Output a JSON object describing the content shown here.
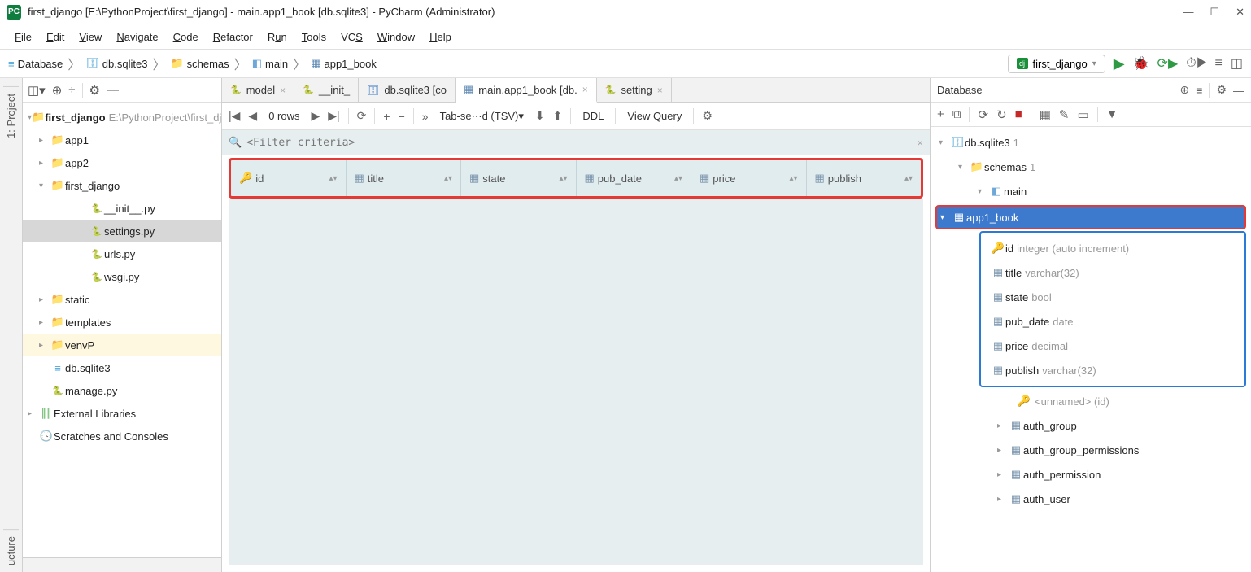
{
  "window": {
    "title": "first_django [E:\\PythonProject\\first_django] - main.app1_book [db.sqlite3] - PyCharm (Administrator)"
  },
  "menu": [
    "File",
    "Edit",
    "View",
    "Navigate",
    "Code",
    "Refactor",
    "Run",
    "Tools",
    "VCS",
    "Window",
    "Help"
  ],
  "breadcrumb": {
    "items": [
      "Database",
      "db.sqlite3",
      "schemas",
      "main",
      "app1_book"
    ]
  },
  "run_config": "first_django",
  "project_tree": {
    "root_name": "first_django",
    "root_path": "E:\\PythonProject\\first_django",
    "items": [
      {
        "label": "app1",
        "ind": 1,
        "arrow": ">",
        "icon": "folder"
      },
      {
        "label": "app2",
        "ind": 1,
        "arrow": ">",
        "icon": "folder"
      },
      {
        "label": "first_django",
        "ind": 1,
        "arrow": "v",
        "icon": "folder"
      },
      {
        "label": "__init__.py",
        "ind": 3,
        "arrow": "",
        "icon": "py"
      },
      {
        "label": "settings.py",
        "ind": 3,
        "arrow": "",
        "icon": "py",
        "selected": true
      },
      {
        "label": "urls.py",
        "ind": 3,
        "arrow": "",
        "icon": "py"
      },
      {
        "label": "wsgi.py",
        "ind": 3,
        "arrow": "",
        "icon": "py"
      },
      {
        "label": "static",
        "ind": 1,
        "arrow": ">",
        "icon": "folder"
      },
      {
        "label": "templates",
        "ind": 1,
        "arrow": ">",
        "icon": "folder-purple"
      },
      {
        "label": "venvP",
        "ind": 1,
        "arrow": ">",
        "icon": "folder-orange"
      },
      {
        "label": "db.sqlite3",
        "ind": 1,
        "arrow": "",
        "icon": "db"
      },
      {
        "label": "manage.py",
        "ind": 1,
        "arrow": "",
        "icon": "py"
      },
      {
        "label": "External Libraries",
        "ind": 0,
        "arrow": ">",
        "icon": "lib"
      },
      {
        "label": "Scratches and Consoles",
        "ind": 0,
        "arrow": "",
        "icon": "scratch"
      }
    ]
  },
  "editor_tabs": [
    {
      "label": "model",
      "kind": "py"
    },
    {
      "label": "__init_",
      "kind": "py"
    },
    {
      "label": "db.sqlite3 [co",
      "kind": "db"
    },
    {
      "label": "main.app1_book [db.",
      "kind": "table",
      "active": true
    },
    {
      "label": "setting",
      "kind": "py"
    }
  ],
  "db_toolbar": {
    "rows_text": "0 rows",
    "tab_text": "Tab-se···d (TSV)",
    "ddl": "DDL",
    "view_query": "View Query"
  },
  "filter_placeholder": "<Filter criteria>",
  "columns": [
    "id",
    "title",
    "state",
    "pub_date",
    "price",
    "publish"
  ],
  "database_panel": {
    "title": "Database",
    "datasource": {
      "name": "db.sqlite3",
      "badge": "1"
    },
    "schemas_label": "schemas",
    "schemas_count": "1",
    "schema_name": "main",
    "selected_table": "app1_book",
    "table_columns": [
      {
        "name": "id",
        "type": "integer (auto increment)",
        "key": true
      },
      {
        "name": "title",
        "type": "varchar(32)"
      },
      {
        "name": "state",
        "type": "bool"
      },
      {
        "name": "pub_date",
        "type": "date"
      },
      {
        "name": "price",
        "type": "decimal"
      },
      {
        "name": "publish",
        "type": "varchar(32)"
      }
    ],
    "unnamed_key": "<unnamed> (id)",
    "other_tables": [
      "auth_group",
      "auth_group_permissions",
      "auth_permission",
      "auth_user"
    ]
  },
  "left_tabs": [
    "1: Project"
  ],
  "left_bottom_tab": "ucture"
}
